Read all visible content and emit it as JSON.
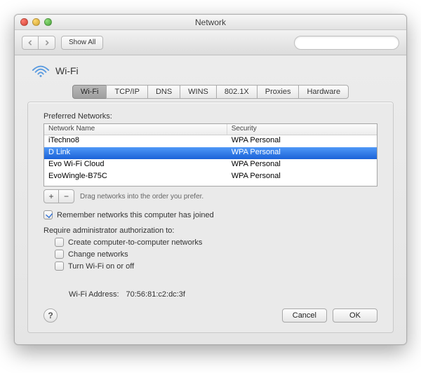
{
  "window": {
    "title": "Network"
  },
  "toolbar": {
    "show_all": "Show All",
    "search_placeholder": ""
  },
  "header": {
    "title": "Wi-Fi"
  },
  "tabs": {
    "items": [
      "Wi-Fi",
      "TCP/IP",
      "DNS",
      "WINS",
      "802.1X",
      "Proxies",
      "Hardware"
    ],
    "active_index": 0
  },
  "preferred": {
    "label": "Preferred Networks:",
    "columns": {
      "name": "Network Name",
      "security": "Security"
    },
    "rows": [
      {
        "name": "iTechno8",
        "security": "WPA Personal",
        "selected": false
      },
      {
        "name": "D Link",
        "security": "WPA Personal",
        "selected": true
      },
      {
        "name": "Evo Wi-Fi Cloud",
        "security": "WPA Personal",
        "selected": false
      },
      {
        "name": "EvoWingle-B75C",
        "security": "WPA Personal",
        "selected": false
      }
    ],
    "add_label": "+",
    "remove_label": "−",
    "hint": "Drag networks into the order you prefer."
  },
  "remember": {
    "label": "Remember networks this computer has joined",
    "checked": true
  },
  "admin": {
    "label": "Require administrator authorization to:",
    "opts": [
      {
        "label": "Create computer-to-computer networks",
        "checked": false
      },
      {
        "label": "Change networks",
        "checked": false
      },
      {
        "label": "Turn Wi-Fi on or off",
        "checked": false
      }
    ]
  },
  "address": {
    "label": "Wi-Fi Address:",
    "value": "70:56:81:c2:dc:3f"
  },
  "buttons": {
    "help": "?",
    "cancel": "Cancel",
    "ok": "OK"
  }
}
